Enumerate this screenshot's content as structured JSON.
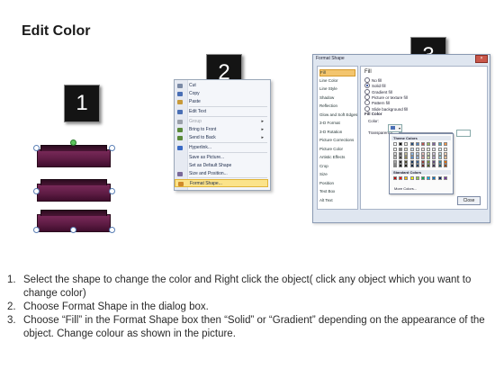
{
  "title": "Edit Color",
  "badges": [
    "1",
    "2",
    "3"
  ],
  "context_menu": {
    "items": [
      {
        "label": "Cut",
        "icon": "scissors-icon",
        "enabled": true,
        "submenu": false
      },
      {
        "label": "Copy",
        "icon": "copy-icon",
        "enabled": true,
        "submenu": false
      },
      {
        "label": "Paste",
        "icon": "paste-icon",
        "enabled": true,
        "submenu": false
      },
      {
        "label": "Edit Text",
        "icon": "edit-text-icon",
        "enabled": true,
        "submenu": false
      },
      {
        "label": "Group",
        "icon": "group-icon",
        "enabled": false,
        "submenu": true
      },
      {
        "label": "Bring to Front",
        "icon": "bring-front-icon",
        "enabled": true,
        "submenu": true
      },
      {
        "label": "Send to Back",
        "icon": "send-back-icon",
        "enabled": true,
        "submenu": true
      },
      {
        "label": "Hyperlink...",
        "icon": "hyperlink-icon",
        "enabled": true,
        "submenu": false
      },
      {
        "label": "Save as Picture...",
        "icon": "",
        "enabled": true,
        "submenu": false
      },
      {
        "label": "Set as Default Shape",
        "icon": "",
        "enabled": true,
        "submenu": false
      },
      {
        "label": "Size and Position...",
        "icon": "size-icon",
        "enabled": true,
        "submenu": false
      },
      {
        "label": "Format Shape...",
        "icon": "format-shape-icon",
        "enabled": true,
        "submenu": false,
        "highlighted": true
      }
    ]
  },
  "dialog": {
    "title": "Format Shape",
    "nav": [
      "Fill",
      "Line Color",
      "Line Style",
      "Shadow",
      "Reflection",
      "Glow and Soft Edges",
      "3-D Format",
      "3-D Rotation",
      "Picture Corrections",
      "Picture Color",
      "Artistic Effects",
      "Crop",
      "Size",
      "Position",
      "Text Box",
      "Alt Text"
    ],
    "selected_nav": "Fill",
    "heading": "Fill",
    "options": [
      "No fill",
      "Solid fill",
      "Gradient fill",
      "Picture or texture fill",
      "Pattern fill",
      "Slide background fill"
    ],
    "selected_option": "Solid fill",
    "fill_color_label": "Fill Color",
    "color_label": "Color:",
    "transparency_label": "Transparency:",
    "close_label": "Close",
    "palette": {
      "theme_label": "Theme Colors",
      "standard_label": "Standard Colors",
      "more_label": "More Colors...",
      "theme_top": [
        "#ffffff",
        "#000000",
        "#eeece1",
        "#1f497d",
        "#4f81bd",
        "#c0504d",
        "#9bbb59",
        "#8064a2",
        "#4bacc6",
        "#f79646"
      ],
      "theme_shades": [
        [
          "#f2f2f2",
          "#7f7f7f",
          "#ddd9c3",
          "#c6d9f0",
          "#dbe5f1",
          "#f2dcdb",
          "#ebf1dd",
          "#e5e0ec",
          "#dbeef3",
          "#fdeada"
        ],
        [
          "#d8d8d8",
          "#595959",
          "#c4bd97",
          "#8db3e2",
          "#b8cce4",
          "#e5b9b7",
          "#d7e3bc",
          "#ccc1d9",
          "#b7dde8",
          "#fbd5b5"
        ],
        [
          "#bfbfbf",
          "#3f3f3f",
          "#938953",
          "#548dd4",
          "#95b3d7",
          "#d99694",
          "#c3d69b",
          "#b2a2c7",
          "#92cddc",
          "#fac08f"
        ],
        [
          "#a5a5a5",
          "#262626",
          "#494429",
          "#17365d",
          "#366092",
          "#953734",
          "#76923c",
          "#5f497a",
          "#31859b",
          "#e36c09"
        ],
        [
          "#7f7f7f",
          "#0c0c0c",
          "#1d1b10",
          "#0f243e",
          "#244061",
          "#632423",
          "#4f6128",
          "#3f3151",
          "#205867",
          "#974806"
        ]
      ],
      "standard": [
        "#c00000",
        "#ff0000",
        "#ffc000",
        "#ffff00",
        "#92d050",
        "#00b050",
        "#00b0f0",
        "#0070c0",
        "#002060",
        "#7030a0"
      ]
    }
  },
  "instructions": [
    {
      "num": "1.",
      "text": "Select the shape to change the color and Right click the object( click any object which you want to change color)"
    },
    {
      "num": "2.",
      "text": "Choose Format Shape in the dialog box."
    },
    {
      "num": "3.",
      "text": "Choose “Fill” in the Format Shape box then “Solid” or “Gradient” depending on the appearance of the object. Change colour as shown in the picture."
    }
  ]
}
